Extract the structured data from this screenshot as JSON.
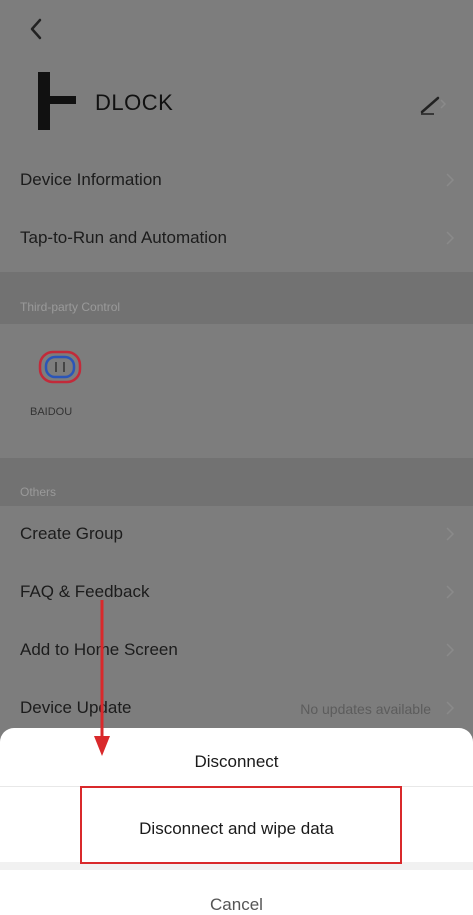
{
  "header": {
    "back_icon": "chevron-left-icon",
    "device_name": "DLOCK",
    "edit_icon": "pencil-icon"
  },
  "menu_top": [
    {
      "label": "Device Information"
    },
    {
      "label": "Tap-to-Run and Automation"
    }
  ],
  "third_party": {
    "title": "Third-party Control",
    "app_name": "BAIDOU"
  },
  "others": {
    "title": "Others",
    "items": [
      {
        "label": "Create Group"
      },
      {
        "label": "FAQ & Feedback"
      },
      {
        "label": "Add to Home Screen"
      },
      {
        "label": "Device Update",
        "value": "No updates available"
      }
    ]
  },
  "action_sheet": {
    "disconnect": "Disconnect",
    "disconnect_wipe": "Disconnect and wipe data",
    "cancel": "Cancel"
  },
  "colors": {
    "overlay": "#7d7d7d",
    "highlight": "#d9292b",
    "sheet_bg": "#ffffff"
  }
}
